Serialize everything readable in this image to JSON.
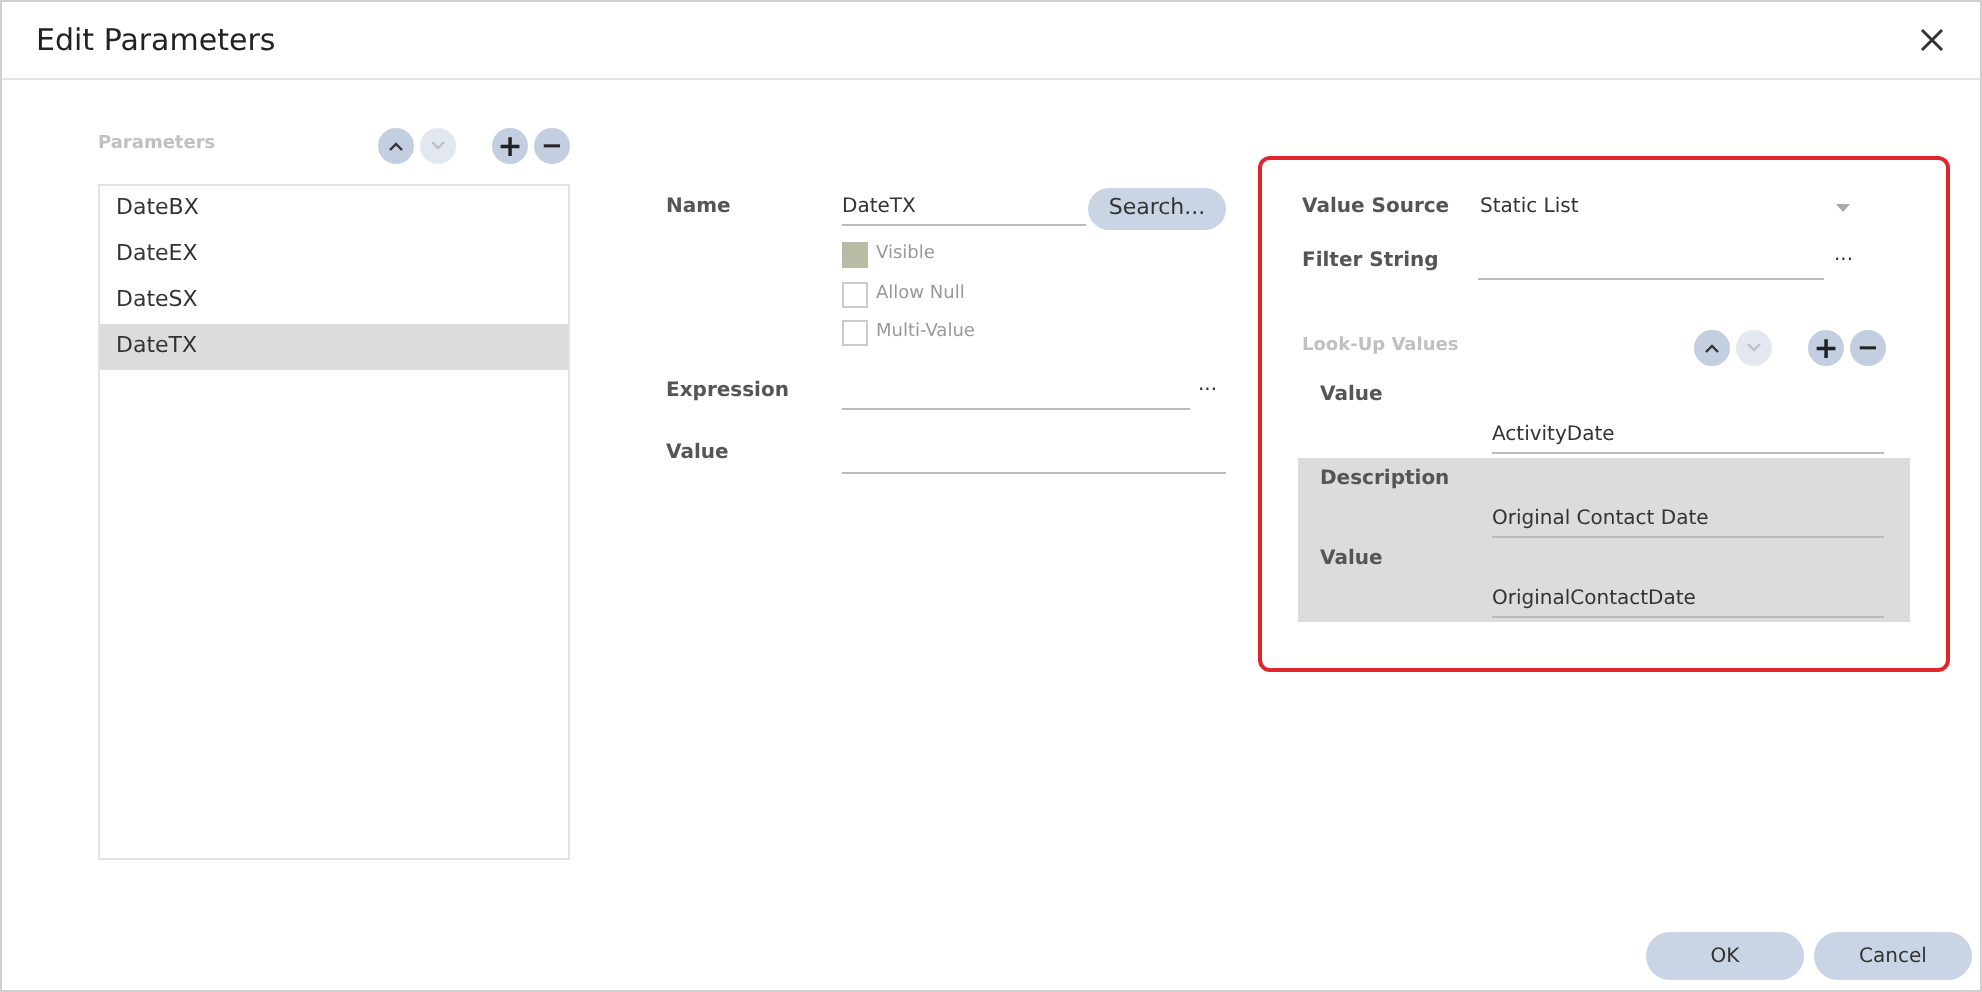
{
  "window": {
    "title": "Edit Parameters"
  },
  "parameters": {
    "label": "Parameters",
    "move_up": {
      "disabled": false
    },
    "move_down": {
      "disabled": true
    },
    "add": "+",
    "remove": "−",
    "items": [
      {
        "label": "DateBX",
        "selected": false
      },
      {
        "label": "DateEX",
        "selected": false
      },
      {
        "label": "DateSX",
        "selected": false
      },
      {
        "label": "DateTX",
        "selected": true
      }
    ]
  },
  "form": {
    "name_label": "Name",
    "name_value": "DateTX",
    "search_button": "Search...",
    "checkboxes": [
      {
        "label": "Visible",
        "checked": true
      },
      {
        "label": "Allow Null",
        "checked": false
      },
      {
        "label": "Multi-Value",
        "checked": false
      }
    ],
    "expression_label": "Expression",
    "expression_button": "...",
    "value_label": "Value"
  },
  "value_panel": {
    "value_source_label": "Value Source",
    "value_source": "Static List",
    "filter_label": "Filter String",
    "filter_button": "...",
    "lookup_label": "Look-Up Values",
    "move_up": {
      "disabled": false
    },
    "move_down": {
      "disabled": true
    },
    "add": "+",
    "remove": "−",
    "entries": [
      {
        "selected": false,
        "fields": [
          {
            "label": "Value",
            "value": "ActivityDate"
          }
        ]
      },
      {
        "selected": true,
        "fields": [
          {
            "label": "Description",
            "value": "Original Contact Date"
          },
          {
            "label": "Value",
            "value": "OriginalContactDate"
          }
        ]
      }
    ]
  },
  "buttons": [
    "OK",
    "Cancel"
  ]
}
